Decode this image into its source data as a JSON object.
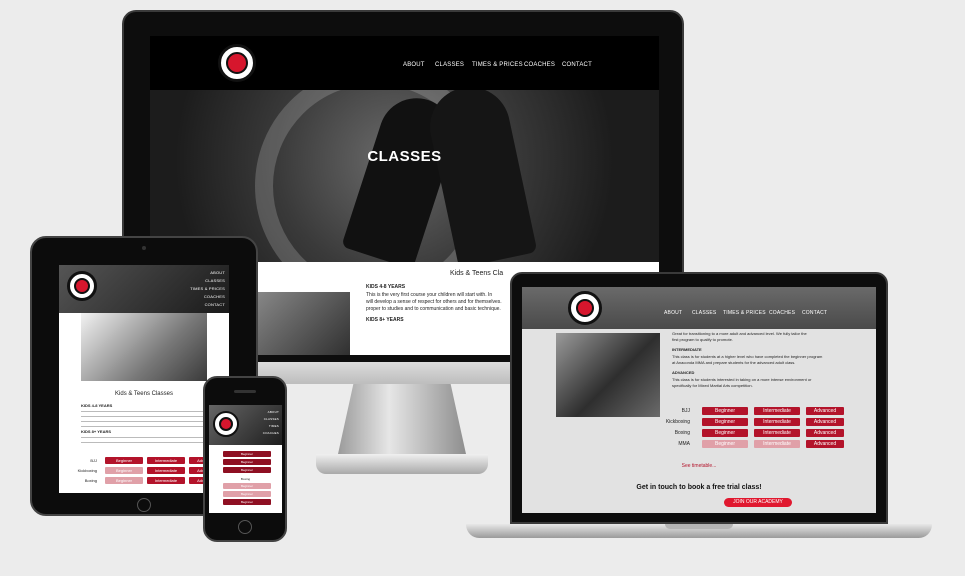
{
  "brand": {
    "accent": "#d6162d",
    "dark": "#000000",
    "page_bg": "#ececec"
  },
  "nav": {
    "items": [
      "ABOUT",
      "CLASSES",
      "TIMES & PRICES",
      "COACHES",
      "CONTACT"
    ]
  },
  "desktop": {
    "hero_title": "CLASSES",
    "section_title": "Kids & Teens Cla",
    "kids_heading": "KIDS 4-8 YEARS",
    "kids_text_1": "This is the very first course your children will start with. In",
    "kids_text_2": "will develop a sense of respect for others and for themselves.",
    "kids_text_3": "proper to studies and to communication and basic technique.",
    "kids2_heading": "KIDS 8+ YEARS"
  },
  "laptop": {
    "line1": "Great for transitioning to a more adult and advanced level. We fully tailor the",
    "line2": "first program to qualify to promote.",
    "intermediate_heading": "INTERMEDIATE",
    "intermediate_text_1": "This class is for students at a higher level who have completed the beginner program",
    "intermediate_text_2": "at Anaconda MMA and prepare students for the advanced adult class.",
    "advanced_heading": "ADVANCED",
    "advanced_text_1": "This class is for students interested in taking on a more intense environment or",
    "advanced_text_2": "specifically for Mixed Martial Arts competition.",
    "rows": [
      {
        "label": "BJJ",
        "cells": [
          "Beginner",
          "Intermediate",
          "Advanced"
        ]
      },
      {
        "label": "Kickboxing",
        "cells": [
          "Beginner",
          "Intermediate",
          "Advanced"
        ]
      },
      {
        "label": "Boxing",
        "cells": [
          "Beginner",
          "Intermediate",
          "Advanced"
        ]
      },
      {
        "label": "MMA",
        "cells": [
          "Beginner",
          "Intermediate",
          "Advanced"
        ]
      }
    ],
    "schedule_link": "See timetable...",
    "cta_heading": "Get in touch to book a free trial class!",
    "cta_button": "JOIN OUR ACADEMY"
  },
  "tablet": {
    "nav_items": [
      "ABOUT",
      "CLASSES",
      "TIMES & PRICES",
      "COACHES",
      "CONTACT"
    ],
    "section_title": "Kids & Teens Classes",
    "kids_heading": "KIDS 4-8 YEARS",
    "kids2_heading": "KIDS 8+ YEARS",
    "rows": [
      {
        "label": "BJJ",
        "cells": [
          "Beginner",
          "Intermediate",
          "Advanced"
        ]
      },
      {
        "label": "Kickboxing",
        "cells": [
          "Beginner",
          "Intermediate",
          "Advanced"
        ]
      },
      {
        "label": "Boxing",
        "cells": [
          "Beginner",
          "Intermediate",
          "Advanced"
        ]
      }
    ]
  },
  "phone": {
    "nav_items": [
      "ABOUT",
      "CLASSES",
      "TIMES",
      "COACHES"
    ],
    "buttons": [
      "Beginner",
      "Beginner",
      "Beginner",
      "Boxing",
      "Beginner",
      "Beginner",
      "Beginner"
    ]
  }
}
